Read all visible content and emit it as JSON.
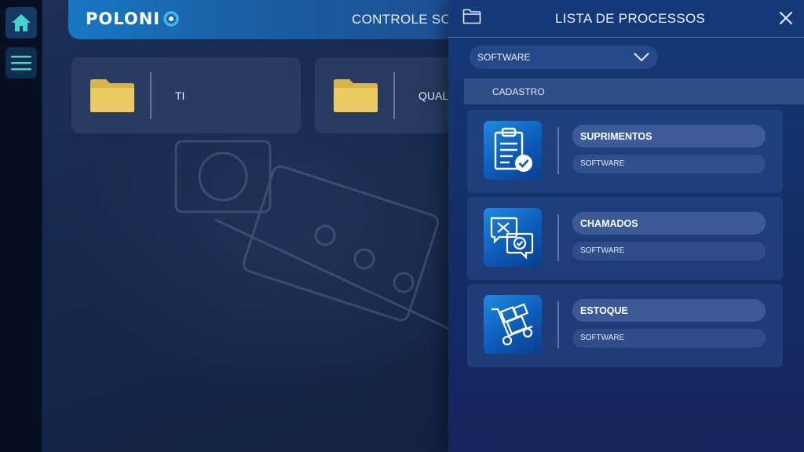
{
  "app": {
    "brand": "POLONI",
    "page_title": "CONTROLE SO"
  },
  "rail": {
    "items": [
      {
        "name": "home",
        "icon": "home-icon"
      },
      {
        "name": "menu",
        "icon": "hamburger-menu-icon"
      }
    ]
  },
  "folders": [
    {
      "label": "TI",
      "icon": "folder-icon"
    },
    {
      "label": "QUAL",
      "icon": "folder-icon"
    }
  ],
  "panel": {
    "title": "LISTA DE PROCESSOS",
    "filter": {
      "selected": "SOFTWARE"
    },
    "section": "CADASTRO",
    "processes": [
      {
        "name": "SUPRIMENTOS",
        "category": "SOFTWARE",
        "icon": "clipboard-check-icon"
      },
      {
        "name": "CHAMADOS",
        "category": "SOFTWARE",
        "icon": "support-chat-icon"
      },
      {
        "name": "ESTOQUE",
        "category": "SOFTWARE",
        "icon": "hand-truck-icon"
      }
    ]
  },
  "colors": {
    "accent": "#3fd0d0",
    "panel_bg": "#15327a",
    "topbar": "#1878c4",
    "folder": "#e8c55a"
  }
}
